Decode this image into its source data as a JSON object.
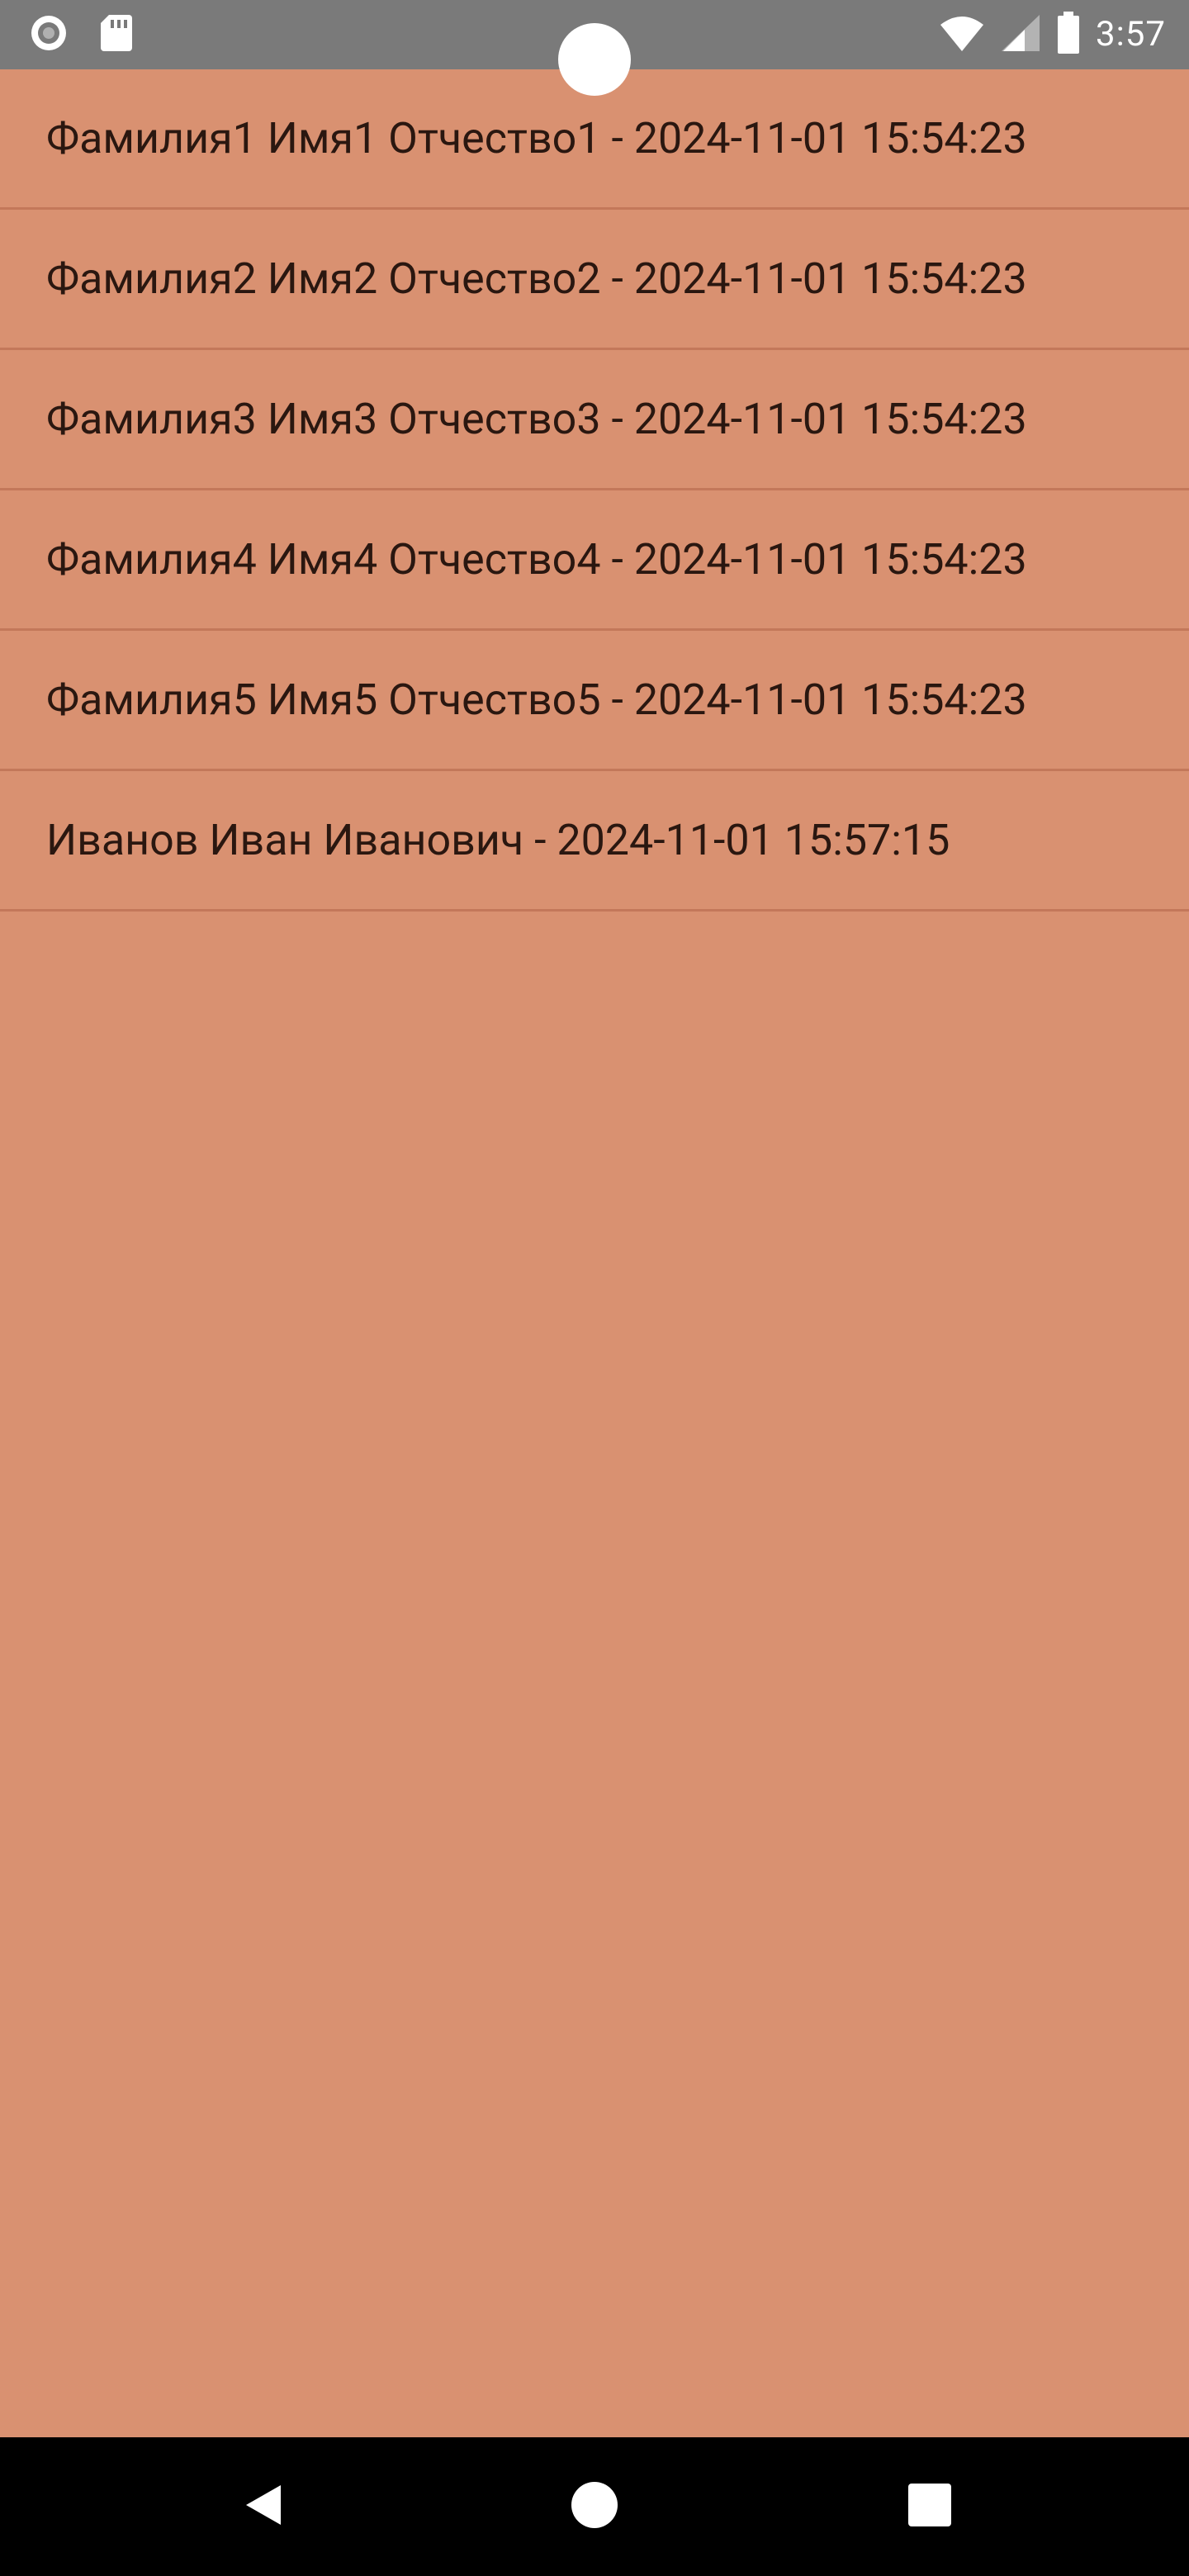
{
  "status_bar": {
    "time": "3:57",
    "left_icons": [
      "circle-record-icon",
      "sd-card-icon"
    ],
    "right_icons": [
      "wifi-icon",
      "cellular-signal-icon",
      "battery-icon"
    ]
  },
  "list": {
    "items": [
      {
        "label": "Фамилия1 Имя1 Отчество1 - 2024-11-01 15:54:23"
      },
      {
        "label": "Фамилия2 Имя2 Отчество2 - 2024-11-01 15:54:23"
      },
      {
        "label": "Фамилия3 Имя3 Отчество3 - 2024-11-01 15:54:23"
      },
      {
        "label": "Фамилия4 Имя4 Отчество4 - 2024-11-01 15:54:23"
      },
      {
        "label": "Фамилия5 Имя5 Отчество5 - 2024-11-01 15:54:23"
      },
      {
        "label": "Иванов Иван Иванович - 2024-11-01 15:57:15"
      }
    ]
  },
  "nav_bar": {
    "buttons": [
      "back-icon",
      "home-icon",
      "recents-icon"
    ]
  },
  "colors": {
    "background": "#D99171",
    "status_bar": "#7A7A7A",
    "divider": "#C3785A",
    "text": "#2A1710",
    "nav_bar": "#000000"
  }
}
